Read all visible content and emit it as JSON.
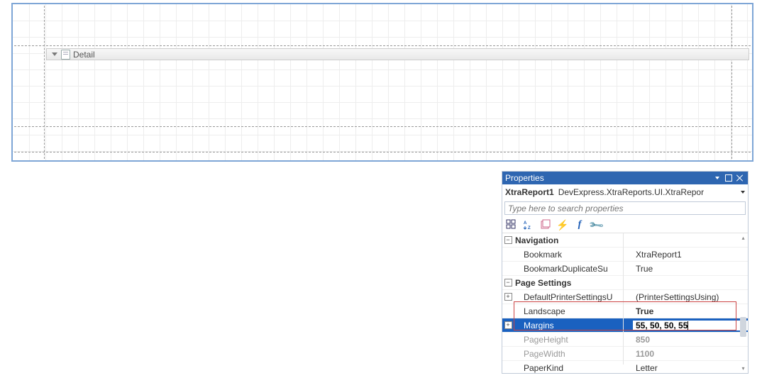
{
  "designer": {
    "band_label": "Detail"
  },
  "properties": {
    "title": "Properties",
    "object_name": "XtraReport1",
    "object_type": "DevExpress.XtraReports.UI.XtraRepor",
    "search_placeholder": "Type here to search properties",
    "categories": [
      {
        "name": "Navigation",
        "expanded": true,
        "rows": [
          {
            "name": "Bookmark",
            "value": "XtraReport1",
            "bold": false,
            "gray": false,
            "expand": ""
          },
          {
            "name": "BookmarkDuplicateSu",
            "value": "True",
            "bold": false,
            "gray": false,
            "expand": ""
          }
        ]
      },
      {
        "name": "Page Settings",
        "expanded": true,
        "rows": [
          {
            "name": "DefaultPrinterSettingsU",
            "value": "(PrinterSettingsUsing)",
            "bold": false,
            "gray": false,
            "expand": "+"
          },
          {
            "name": "Landscape",
            "value": "True",
            "bold": true,
            "gray": false,
            "expand": "",
            "highlight": true
          },
          {
            "name": "Margins",
            "value": "55, 50, 50, 55",
            "bold": true,
            "gray": false,
            "expand": "+",
            "selected": true,
            "highlight": true
          },
          {
            "name": "PageHeight",
            "value": "850",
            "bold": true,
            "gray": true,
            "expand": ""
          },
          {
            "name": "PageWidth",
            "value": "1100",
            "bold": true,
            "gray": true,
            "expand": ""
          },
          {
            "name": "PaperKind",
            "value": "Letter",
            "bold": false,
            "gray": false,
            "expand": ""
          }
        ]
      }
    ]
  },
  "icons": {
    "categorized": "categorized-icon",
    "alphabetical": "alphabetical-icon",
    "property-pages": "property-pages-icon",
    "events": "events-icon",
    "expressions": "expressions-icon",
    "settings": "settings-icon"
  }
}
